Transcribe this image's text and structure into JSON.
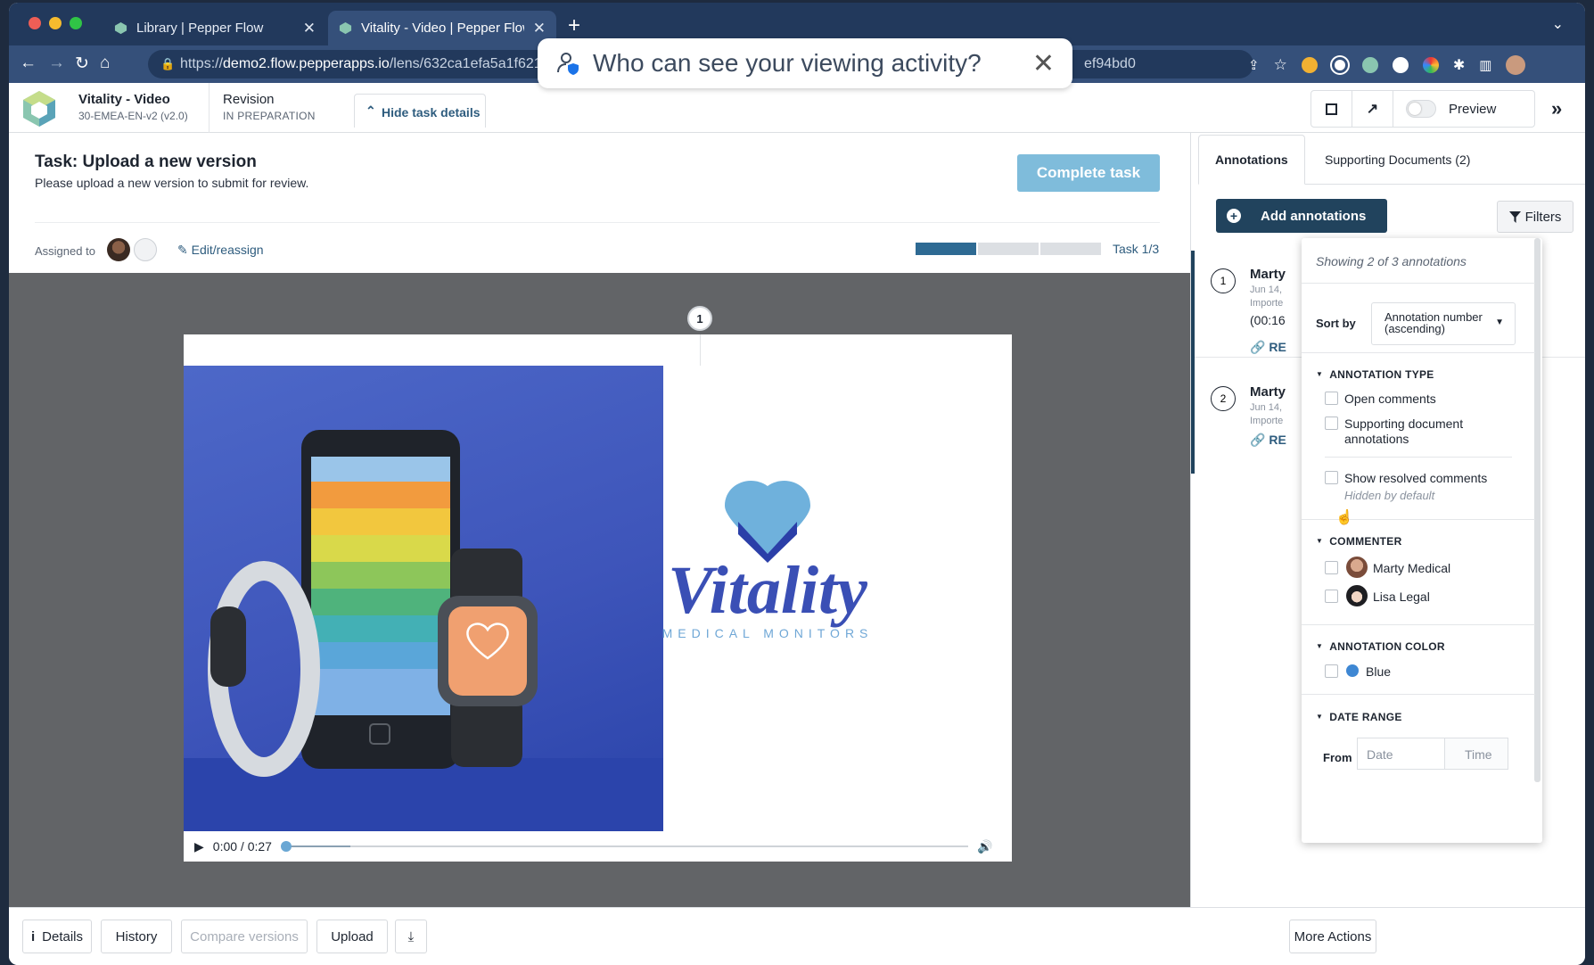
{
  "browser": {
    "tabs": [
      {
        "label": "Library | Pepper Flow",
        "active": false
      },
      {
        "label": "Vitality - Video | Pepper Flow",
        "active": true
      }
    ],
    "url_prefix": "https://",
    "url_host": "demo2.flow.pepperapps.io",
    "url_path": "/lens/632ca1efa5a1f621",
    "url_tail": "ef94bd0",
    "privacy_prompt": "Who can see your viewing activity?"
  },
  "header": {
    "title": "Vitality - Video",
    "subtitle": "30-EMEA-EN-v2 (v2.0)",
    "stage": "Revision",
    "status": "IN PREPARATION",
    "hide_task_label": "Hide task details",
    "preview_label": "Preview"
  },
  "task": {
    "title": "Task: Upload a new version",
    "description": "Please upload a new version to submit for review.",
    "complete_label": "Complete task",
    "assigned_label": "Assigned to",
    "edit_label": "Edit/reassign",
    "progress_label": "Task 1/3",
    "progress": {
      "current": 1,
      "total": 3
    }
  },
  "viewer": {
    "pin_number": "1",
    "time": "0:00 / 0:27",
    "progress_fraction": 0.0,
    "brand_name": "Vitality",
    "brand_tagline": "MEDICAL MONITORS"
  },
  "panel": {
    "tabs": [
      "Annotations",
      "Supporting Documents (2)"
    ],
    "add_label": "Add annotations",
    "filters_label": "Filters",
    "annotations": [
      {
        "num": "1",
        "name": "Marty",
        "date": "Jun 14,",
        "imported": "Importe",
        "time": "(00:16",
        "reply": "RE"
      },
      {
        "num": "2",
        "name": "Marty",
        "date": "Jun 14,",
        "imported": "Importe",
        "reply": "RE"
      }
    ]
  },
  "filters": {
    "showing": "Showing 2 of 3 annotations",
    "sort_label": "Sort by",
    "sort_value_line1": "Annotation number",
    "sort_value_line2": "(ascending)",
    "type_title": "ANNOTATION TYPE",
    "type_options": [
      "Open comments",
      "Supporting document annotations",
      "Show resolved comments"
    ],
    "resolved_hint": "Hidden by default",
    "commenter_title": "COMMENTER",
    "commenters": [
      "Marty Medical",
      "Lisa Legal"
    ],
    "color_title": "ANNOTATION COLOR",
    "color_option": "Blue",
    "color_hex": "#3e87d3",
    "date_title": "DATE RANGE",
    "from_label": "From",
    "date_placeholder": "Date",
    "time_placeholder": "Time"
  },
  "footer": {
    "details": "Details",
    "history": "History",
    "compare": "Compare versions",
    "upload": "Upload",
    "more": "More Actions"
  }
}
